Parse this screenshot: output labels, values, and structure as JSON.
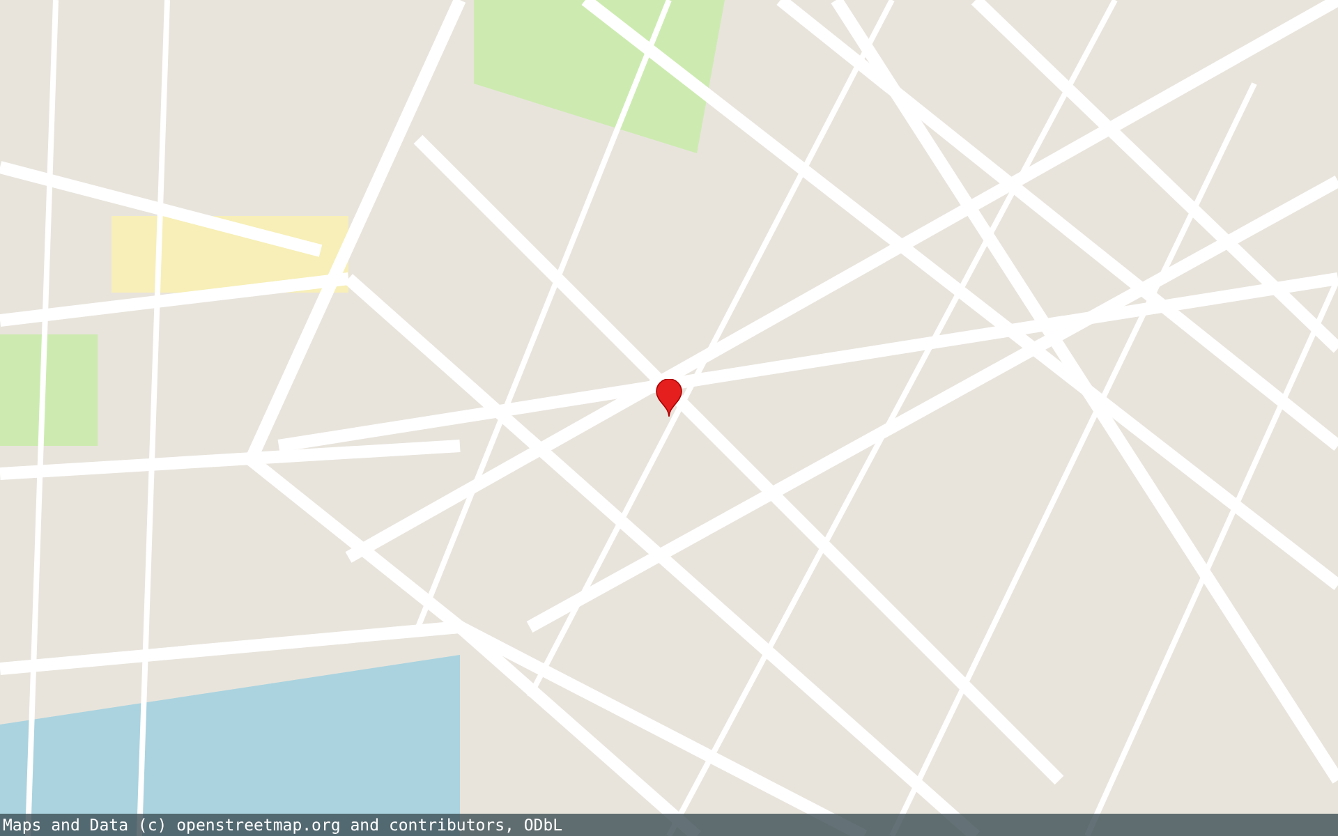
{
  "map": {
    "marker": {
      "kind": "pin"
    }
  },
  "attribution": "Maps and Data (c) openstreetmap.org and contributors, ODbL"
}
